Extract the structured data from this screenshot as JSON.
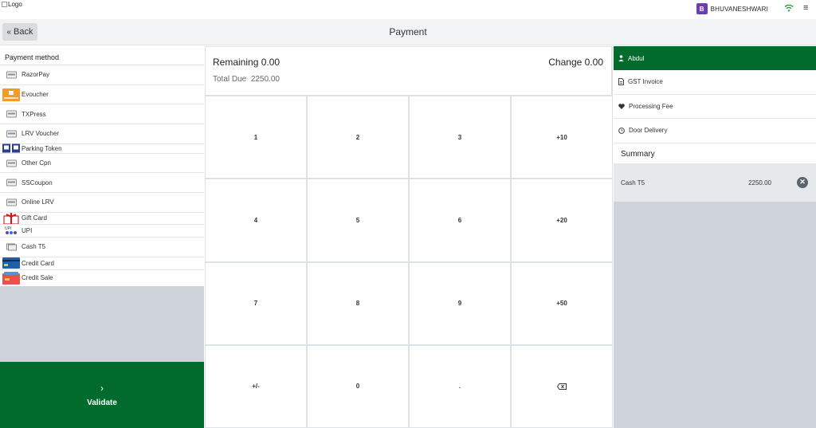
{
  "topbar": {
    "logo_alt": "Logo",
    "user_initial": "B",
    "user_name": "BHUVANESHWARI",
    "menu_glyph": "≡"
  },
  "header": {
    "back_label": "Back",
    "title": "Payment"
  },
  "payment_methods": {
    "title": "Payment method",
    "items": [
      {
        "label": "RazorPay",
        "icon": "card-icon"
      },
      {
        "label": "Evoucher",
        "icon": "evoucher-icon"
      },
      {
        "label": "TXPress",
        "icon": "card-icon"
      },
      {
        "label": "LRV Voucher",
        "icon": "card-icon"
      },
      {
        "label": "Parking Token",
        "icon": "parking-icon"
      },
      {
        "label": "Other Cpn",
        "icon": "card-icon"
      },
      {
        "label": "SSCoupon",
        "icon": "card-icon"
      },
      {
        "label": "Online LRV",
        "icon": "card-icon"
      },
      {
        "label": "Gift Card",
        "icon": "gift-icon"
      },
      {
        "label": "UPI",
        "icon": "upi-icon"
      },
      {
        "label": "Cash T5",
        "icon": "cash-icon"
      },
      {
        "label": "Credit Card",
        "icon": "credit-card-icon"
      },
      {
        "label": "Credit Sale",
        "icon": "credit-sale-icon"
      }
    ],
    "validate_label": "Validate"
  },
  "amounts": {
    "remaining": "Remaining 0.00",
    "change": "Change 0.00",
    "total_due_label": "Total Due",
    "total_due_value": "2250.00"
  },
  "keypad": [
    "1",
    "2",
    "3",
    "+10",
    "4",
    "5",
    "6",
    "+20",
    "7",
    "8",
    "9",
    "+50",
    "+/-",
    "0",
    "."
  ],
  "right_panel": {
    "customer": "Abdul",
    "options": [
      {
        "label": "GST Invoice",
        "icon": "document-icon"
      },
      {
        "label": "Processing Fee",
        "icon": "heart-icon"
      },
      {
        "label": "Door Delivery",
        "icon": "clock-icon"
      }
    ],
    "summary_title": "Summary",
    "lines": [
      {
        "name": "Cash T5",
        "amount": "2250.00"
      }
    ]
  },
  "colors": {
    "primary_green": "#006b2d",
    "avatar_purple": "#6a3fb0",
    "wifi_green": "#1aa03a",
    "panel_gray": "#ced3d9"
  }
}
